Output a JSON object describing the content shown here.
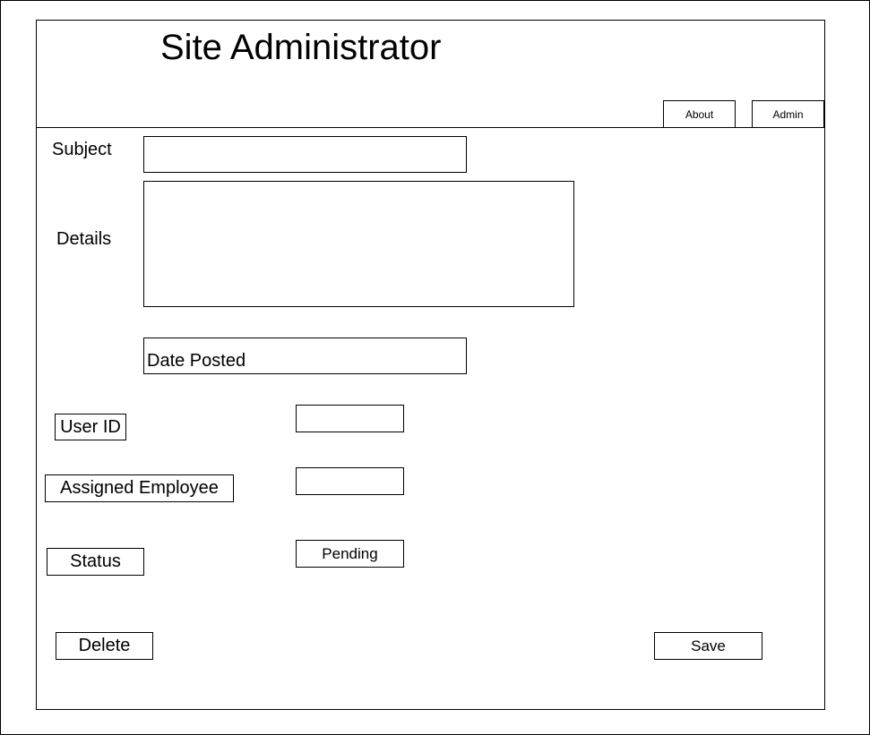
{
  "header": {
    "title": "Site Administrator",
    "nav": {
      "about_label": "About",
      "admin_label": "Admin"
    }
  },
  "form": {
    "subject": {
      "label": "Subject",
      "value": ""
    },
    "details": {
      "label": "Details",
      "value": ""
    },
    "date_posted": {
      "text": "Date Posted"
    },
    "user_id": {
      "label": "User ID",
      "value": ""
    },
    "assigned_employee": {
      "label": "Assigned Employee",
      "value": ""
    },
    "status": {
      "label": "Status",
      "value": "Pending"
    }
  },
  "actions": {
    "delete_label": "Delete",
    "save_label": "Save"
  }
}
